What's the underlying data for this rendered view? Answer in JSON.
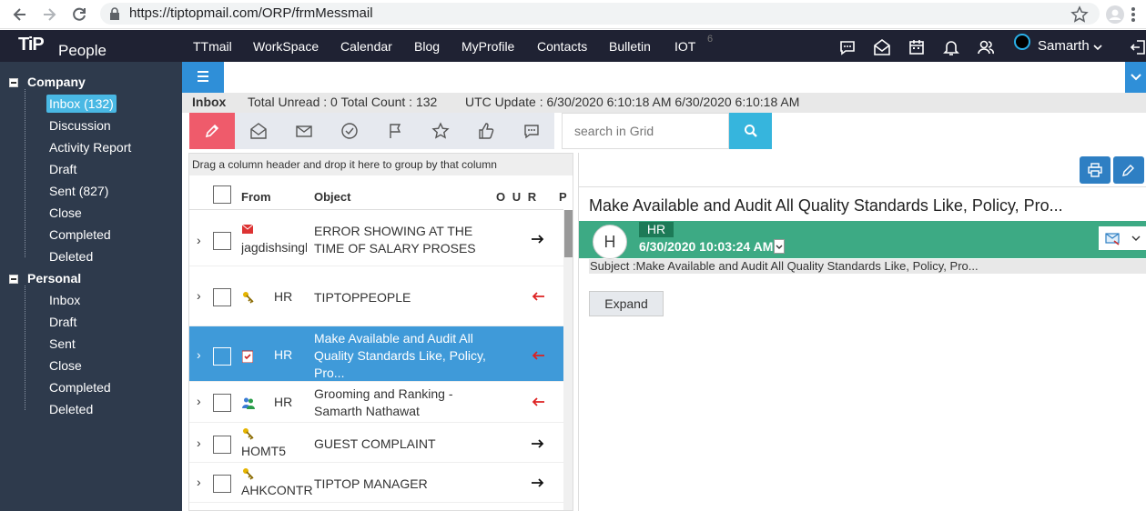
{
  "browser": {
    "url": "https://tiptopmail.com/ORP/frmMessmail"
  },
  "app": {
    "logo": "TiP",
    "logo_sub": "People",
    "nav": [
      "TTmail",
      "WorkSpace",
      "Calendar",
      "Blog",
      "MyProfile",
      "Contacts",
      "Bulletin",
      "IOT"
    ],
    "iot_badge": "6",
    "user": "Samarth"
  },
  "sidebar": {
    "company": {
      "title": "Company",
      "items": [
        "Inbox (132)",
        "Discussion",
        "Activity Report",
        "Draft",
        "Sent (827)",
        "Close",
        "Completed",
        "Deleted"
      ]
    },
    "personal": {
      "title": "Personal",
      "items": [
        "Inbox",
        "Draft",
        "Sent",
        "Close",
        "Completed",
        "Deleted"
      ]
    }
  },
  "infobar": {
    "folder": "Inbox",
    "stats": "Total Unread : 0 Total Count : 132",
    "utc": "UTC Update :  6/30/2020 6:10:18 AM 6/30/2020 6:10:18 AM"
  },
  "search": {
    "placeholder": "search in Grid"
  },
  "grid": {
    "group_hint": "Drag a column header and drop it here to group by that column",
    "headers": {
      "from": "From",
      "object": "Object",
      "flags": "O U R",
      "p": "P"
    },
    "rows": [
      {
        "from": "jagdishsingh",
        "object": "ERROR SHOWING AT THE TIME OF SALARY PROSES",
        "dir": "out"
      },
      {
        "from": "HR",
        "object": "TIPTOPPEOPLE",
        "dir": "in"
      },
      {
        "from": "HR",
        "object": "Make Available and Audit All Quality Standards Like, Policy, Pro...",
        "dir": "in"
      },
      {
        "from": "HR",
        "object": "Grooming and Ranking - Samarth Nathawat",
        "dir": "in"
      },
      {
        "from": "HOMT5",
        "object": "GUEST COMPLAINT",
        "dir": "out"
      },
      {
        "from": "AHKCONTR",
        "object": "TIPTOP MANAGER",
        "dir": "out"
      }
    ]
  },
  "pane": {
    "title": "Make Available and Audit All Quality Standards Like, Policy, Pro...",
    "avatar": "H",
    "sender": "HR",
    "date": "6/30/2020 10:03:24 AM",
    "subject": "Subject :Make Available and Audit All Quality Standards Like, Policy, Pro...",
    "expand": "Expand"
  },
  "colors": {
    "appbar": "#1f2233",
    "sidebar": "#2e3a4c",
    "accent": "#2f8fd8",
    "selected_row": "#3f9ad9",
    "mail_head": "#3daa84",
    "compose": "#ef5b6b",
    "search_btn": "#36b5dd"
  }
}
